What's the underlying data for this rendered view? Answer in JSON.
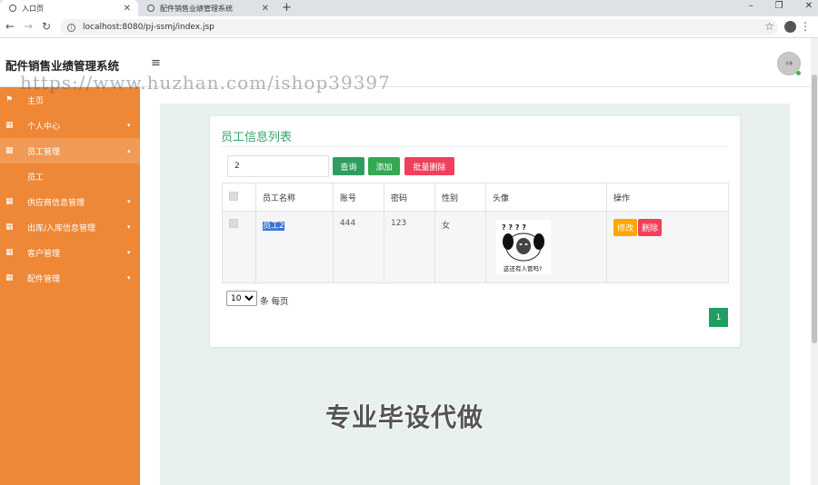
{
  "browser": {
    "tabs": [
      {
        "title": "入口页"
      },
      {
        "title": "配件销售业绩管理系统"
      }
    ],
    "new_tab": "+",
    "url": "localhost:8080/pj-ssmj/index.jsp"
  },
  "header": {
    "title": "配件销售业绩管理系统",
    "menu_toggle": "≡",
    "avatar_text": "头像"
  },
  "watermark_url": "https://www.huzhan.com/ishop39397",
  "sidebar": {
    "items": [
      {
        "label": "主页",
        "icon": "flag-icon",
        "caret": false
      },
      {
        "label": "个人中心",
        "icon": "grid-icon",
        "caret": true
      },
      {
        "label": "员工管理",
        "icon": "grid-icon",
        "caret": true
      },
      {
        "label": "员工",
        "icon": "",
        "caret": false
      },
      {
        "label": "供应商信息管理",
        "icon": "grid-icon",
        "caret": true
      },
      {
        "label": "出库/入库信息管理",
        "icon": "grid-icon",
        "caret": true
      },
      {
        "label": "客户管理",
        "icon": "grid-icon",
        "caret": true
      },
      {
        "label": "配件管理",
        "icon": "grid-icon",
        "caret": true
      }
    ]
  },
  "card": {
    "title": "员工信息列表",
    "search_value": "2",
    "buttons": {
      "query": "查询",
      "add": "添加",
      "batch_delete": "批量删除"
    }
  },
  "table": {
    "headers": [
      "员工名称",
      "账号",
      "密码",
      "性别",
      "头像",
      "操作"
    ],
    "rows": [
      {
        "name": "员工2",
        "account": "444",
        "password": "123",
        "gender": "女",
        "avatar_caption": "这还有人管吗?",
        "avatar_marks": "? ? ? ?"
      }
    ],
    "actions": {
      "edit": "修改",
      "delete": "删除"
    }
  },
  "pagination": {
    "page_size": "10",
    "page_size_label": "条 每页",
    "current_page": "1"
  },
  "watermark_text": "专业毕设代做",
  "colors": {
    "sidebar": "#ee8736",
    "accent_green": "#2e9e5e",
    "danger": "#f0405b",
    "warning": "#ffa600",
    "title_green": "#35a56a"
  }
}
